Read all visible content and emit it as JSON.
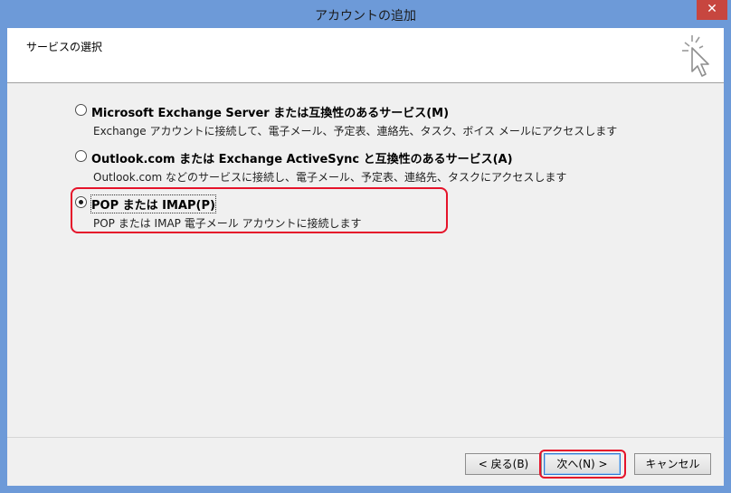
{
  "window": {
    "title": "アカウントの追加",
    "close_glyph": "✕"
  },
  "header": {
    "title": "サービスの選択",
    "icon": "wizard-cursor-icon"
  },
  "options": [
    {
      "label": "Microsoft Exchange Server または互換性のあるサービス(M)",
      "description": "Exchange アカウントに接続して、電子メール、予定表、連絡先、タスク、ボイス メールにアクセスします",
      "selected": false
    },
    {
      "label": "Outlook.com または Exchange ActiveSync と互換性のあるサービス(A)",
      "description": "Outlook.com などのサービスに接続し、電子メール、予定表、連絡先、タスクにアクセスします",
      "selected": false
    },
    {
      "label": "POP または IMAP(P)",
      "description": "POP または IMAP 電子メール アカウントに接続します",
      "selected": true
    }
  ],
  "buttons": {
    "back": "< 戻る(B)",
    "next": "次へ(N) >",
    "cancel": "キャンセル"
  },
  "colors": {
    "titlebar": "#6d9ad8",
    "close": "#c7463f",
    "highlight": "#e5132a"
  }
}
